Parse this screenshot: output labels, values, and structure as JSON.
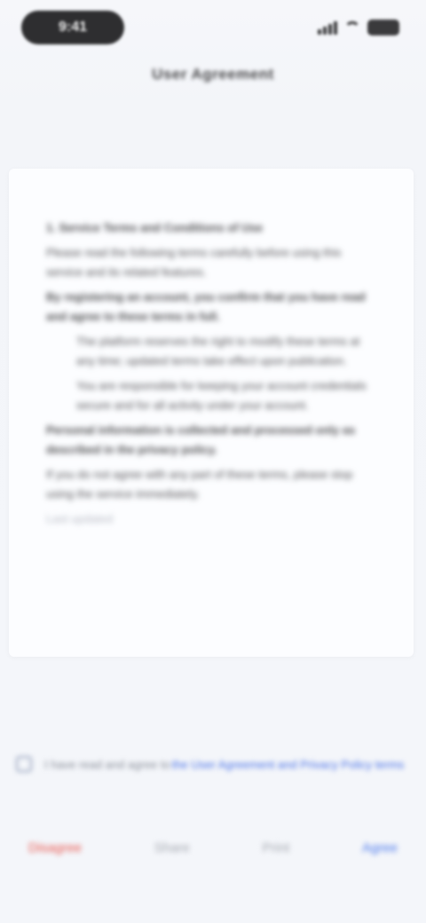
{
  "status_bar": {
    "time": "9:41"
  },
  "nav": {
    "title": "User Agreement"
  },
  "document": {
    "paragraphs": [
      "1. Service Terms and Conditions of Use",
      "Please read the following terms carefully before using this service and its related features.",
      "By registering an account, you confirm that you have read and agree to these terms in full.",
      "The platform reserves the right to modify these terms at any time; updated terms take effect upon publication.",
      "You are responsible for keeping your account credentials secure and for all activity under your account.",
      "Personal information is collected and processed only as described in the privacy policy.",
      "If you do not agree with any part of these terms, please stop using the service immediately.",
      "Last updated"
    ]
  },
  "agreement": {
    "text": "I have read and agree to",
    "link": "the User Agreement and Privacy Policy terms"
  },
  "toolbar": {
    "reject_label": "Disagree",
    "mid1_label": "Share",
    "mid2_label": "Print",
    "accept_label": "Agree"
  },
  "colors": {
    "accent": "#4a78ec",
    "danger": "#e8554d"
  }
}
